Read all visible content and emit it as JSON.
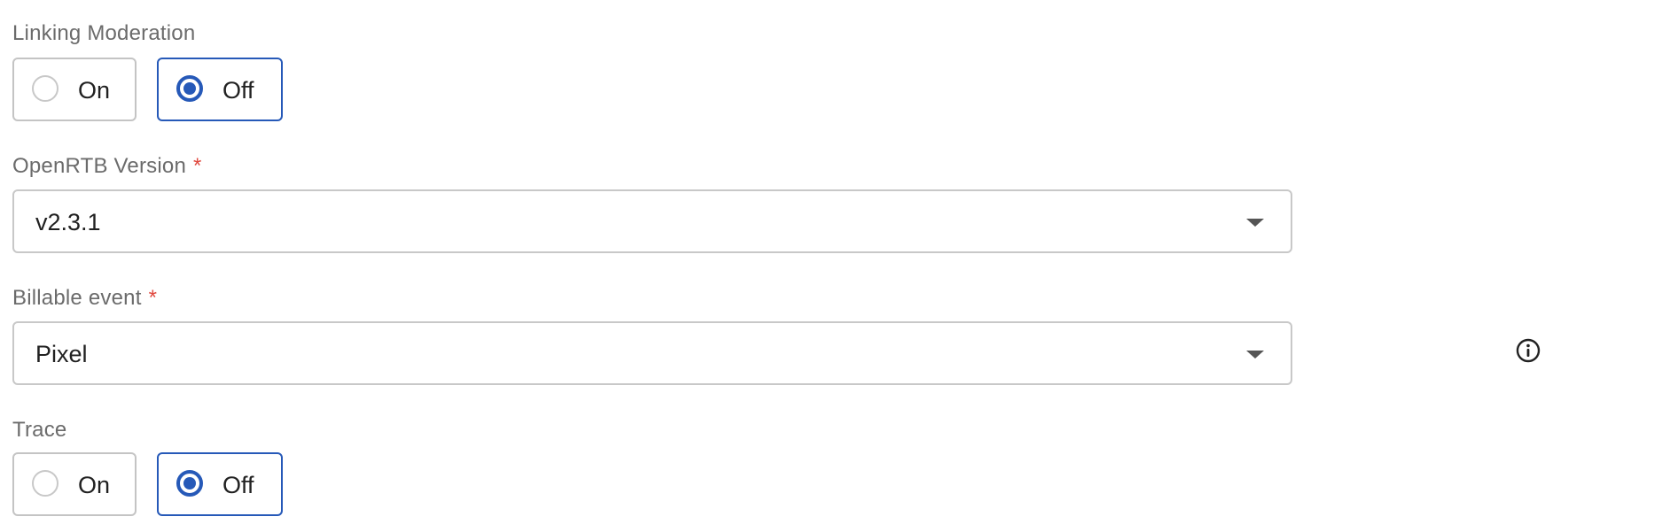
{
  "linking_moderation": {
    "label": "Linking Moderation",
    "options": [
      {
        "label": "On",
        "selected": false
      },
      {
        "label": "Off",
        "selected": true
      }
    ]
  },
  "openrtb_version": {
    "label": "OpenRTB Version",
    "required_mark": "*",
    "value": "v2.3.1"
  },
  "billable_event": {
    "label": "Billable event",
    "required_mark": "*",
    "value": "Pixel",
    "info_icon": "info-icon"
  },
  "trace": {
    "label": "Trace",
    "options": [
      {
        "label": "On",
        "selected": false
      },
      {
        "label": "Off",
        "selected": true
      }
    ]
  },
  "colors": {
    "accent": "#2659b8",
    "required": "#e0483e",
    "label": "#6b6b6b",
    "border": "#c8c8c8"
  }
}
